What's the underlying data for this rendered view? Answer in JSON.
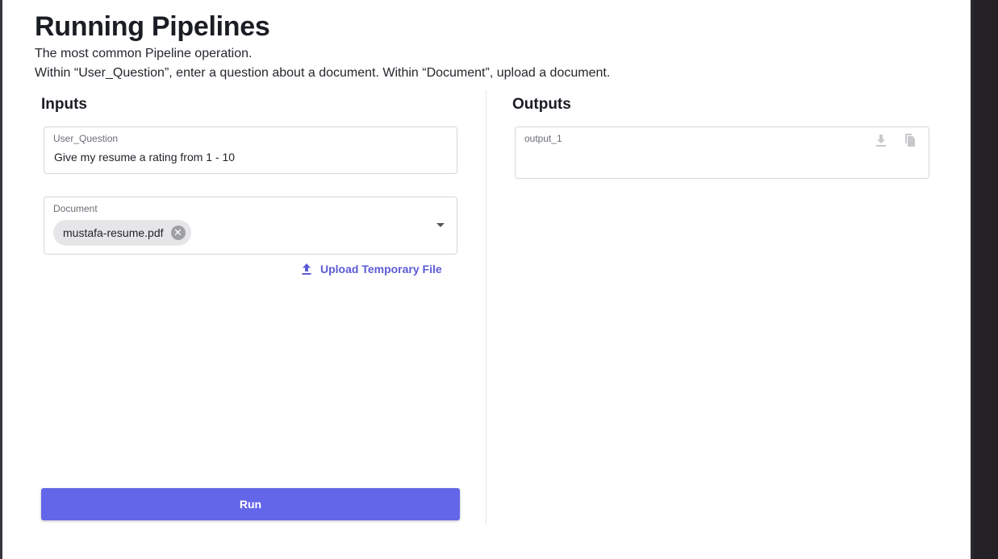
{
  "header": {
    "title": "Running Pipelines",
    "subtitle": "The most common Pipeline operation.",
    "instructions": "Within “User_Question”, enter a question about a document. Within “Document”, upload a document."
  },
  "inputs": {
    "heading": "Inputs",
    "user_question": {
      "label": "User_Question",
      "value": "Give my resume a rating from 1 - 10"
    },
    "document": {
      "label": "Document",
      "selected_file": "mustafa-resume.pdf"
    },
    "upload_label": "Upload Temporary File",
    "run_label": "Run"
  },
  "outputs": {
    "heading": "Outputs",
    "output_1": {
      "label": "output_1",
      "value": ""
    }
  },
  "colors": {
    "accent": "#6366e8",
    "link": "#5b5bd6"
  },
  "icons": {
    "chip_remove": "close-circle-icon",
    "dropdown": "caret-down-icon",
    "upload": "upload-icon",
    "download": "download-icon",
    "copy": "copy-icon"
  }
}
